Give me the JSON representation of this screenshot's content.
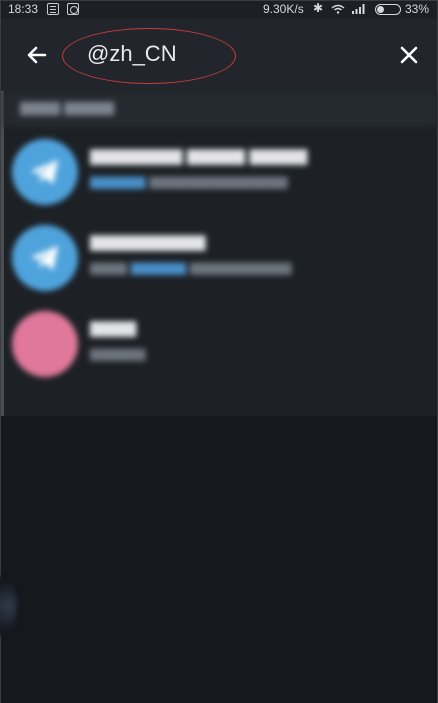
{
  "status_bar": {
    "time": "18:33",
    "network_speed": "9.30K/s",
    "battery_percent": "33%",
    "battery_level": 0.33,
    "icons": [
      "notification-icon",
      "sync-icon",
      "bluetooth-icon",
      "wifi-icon",
      "signal-icon",
      "battery-icon"
    ]
  },
  "search": {
    "value": "@zh_CN",
    "annotation_color": "#c73a3a"
  },
  "colors": {
    "header_bg": "#22262c",
    "results_bg": "#1d2126",
    "avatar_blue": "#4fa3dc",
    "avatar_pink": "#e0789b"
  }
}
